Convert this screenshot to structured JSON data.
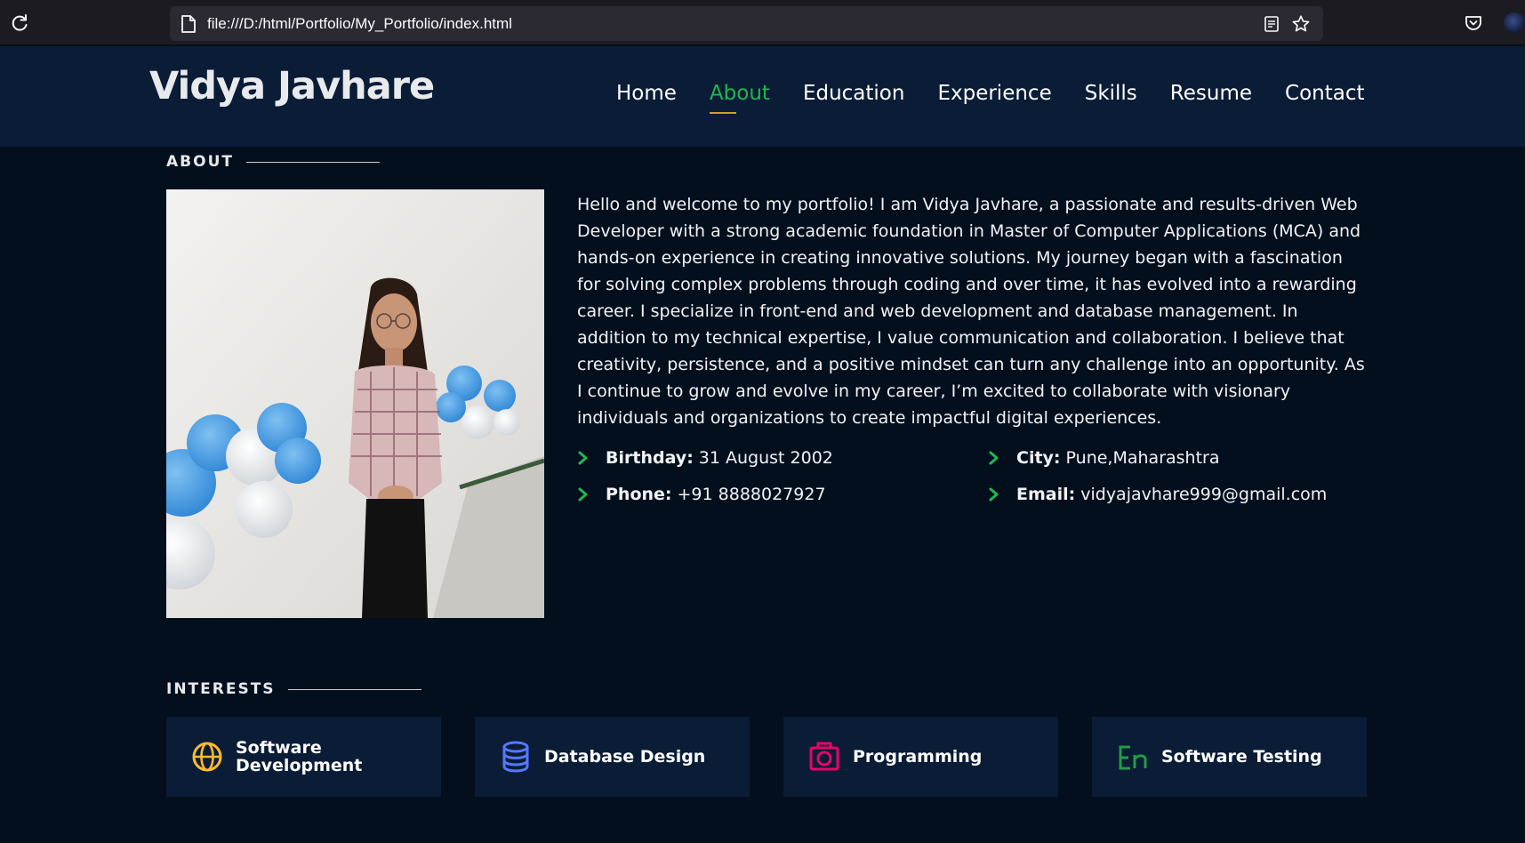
{
  "browser": {
    "url": "file:///D:/html/Portfolio/My_Portfolio/index.html"
  },
  "header": {
    "brand": "Vidya Javhare",
    "nav": [
      {
        "label": "Home"
      },
      {
        "label": "About",
        "active": true
      },
      {
        "label": "Education"
      },
      {
        "label": "Experience"
      },
      {
        "label": "Skills"
      },
      {
        "label": "Resume"
      },
      {
        "label": "Contact"
      }
    ]
  },
  "about": {
    "title": "ABOUT",
    "bio": "Hello and welcome to my portfolio! I am Vidya Javhare, a passionate and results-driven Web Developer with a strong academic foundation in Master of Computer Applications (MCA) and hands-on experience in creating innovative solutions. My journey began with a fascination for solving complex problems through coding and over time, it has evolved into a rewarding career. I specialize in front-end and web development and database management. In addition to my technical expertise, I value communication and collaboration. I believe that creativity, persistence, and a positive mindset can turn any challenge into an opportunity. As I continue to grow and evolve in my career, I’m excited to collaborate with visionary individuals and organizations to create impactful digital experiences.",
    "facts": {
      "birthday": {
        "label": "Birthday:",
        "value": "31 August 2002"
      },
      "city": {
        "label": "City:",
        "value": "Pune,Maharashtra"
      },
      "phone": {
        "label": "Phone:",
        "value": "+91 8888027927"
      },
      "email": {
        "label": "Email:",
        "value": "vidyajavhare999@gmail.com"
      }
    }
  },
  "interests": {
    "title": "INTERESTS",
    "items": [
      {
        "label": "Software Development",
        "icon": "globe-icon",
        "color": "#ffbb2c"
      },
      {
        "label": "Database Design",
        "icon": "database-icon",
        "color": "#5578ff"
      },
      {
        "label": "Programming",
        "icon": "camera-icon",
        "color": "#e80368"
      },
      {
        "label": "Software Testing",
        "icon": "translate-icon",
        "color": "#1f9d45"
      }
    ]
  },
  "colors": {
    "accent": "#1fb84f",
    "header_bg": "#0a1c36",
    "page_bg": "#040f1e"
  }
}
